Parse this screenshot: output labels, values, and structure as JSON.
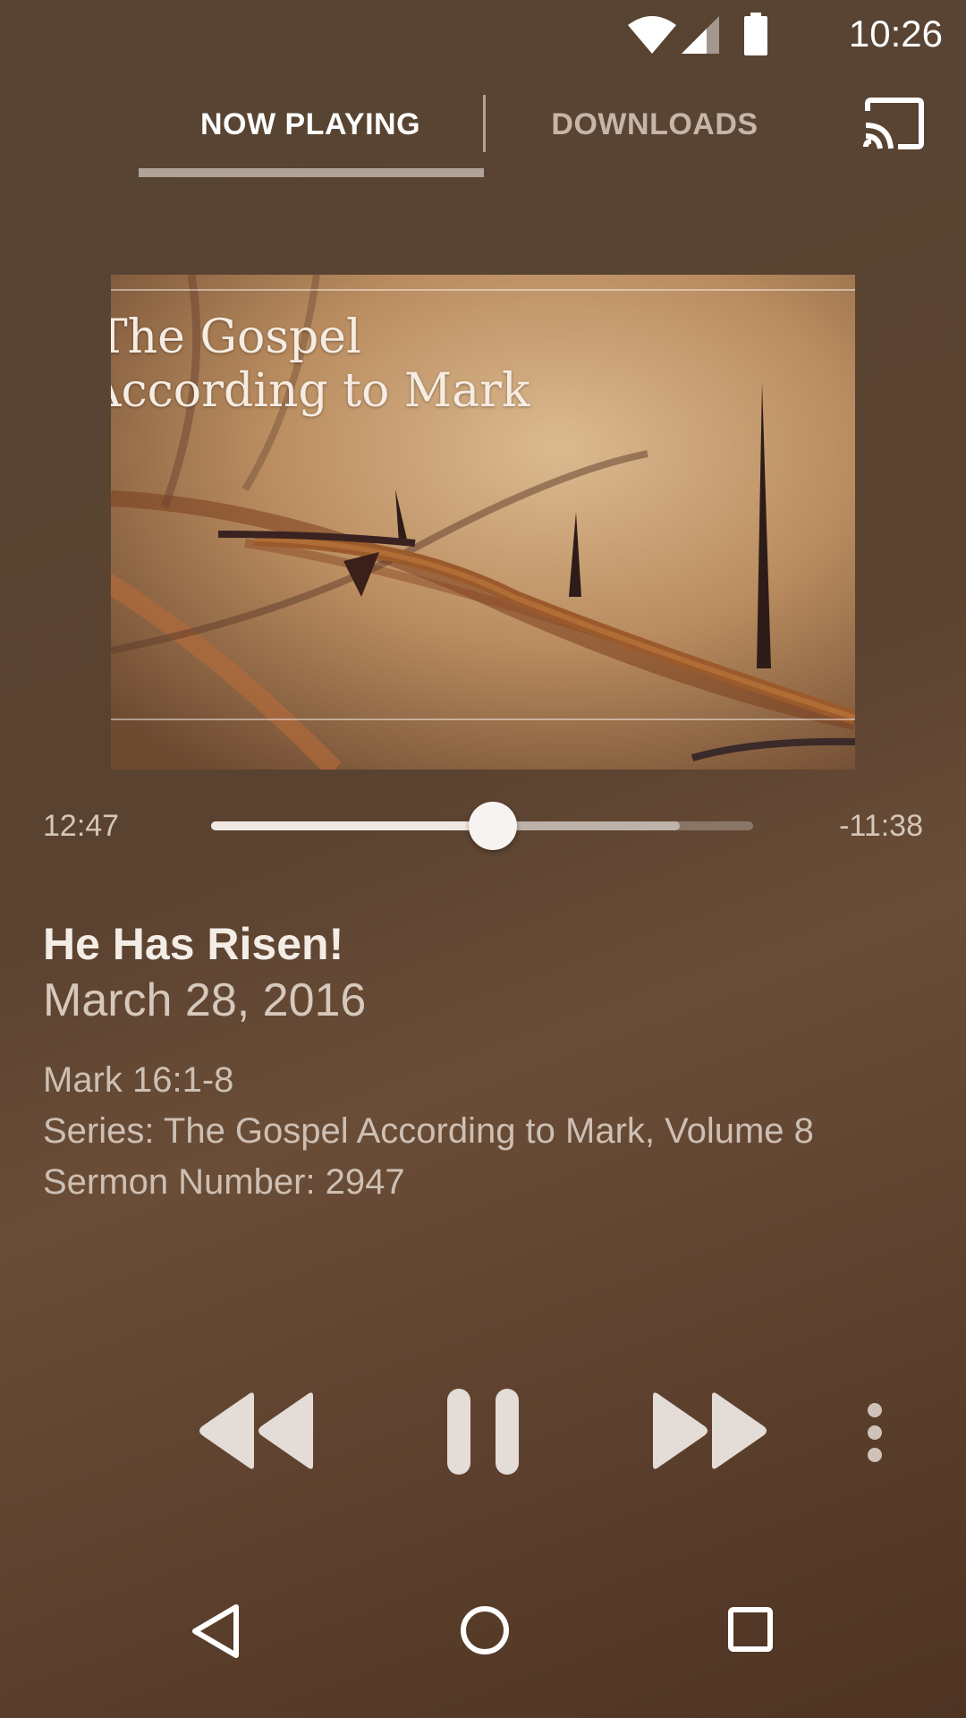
{
  "status_bar": {
    "time": "10:26",
    "icons": [
      "wifi-icon",
      "cell-signal-icon",
      "battery-icon"
    ]
  },
  "tabs": [
    {
      "label": "NOW PLAYING",
      "selected": true
    },
    {
      "label": "DOWNLOADS",
      "selected": false
    }
  ],
  "cast_icon": "cast-icon",
  "artwork": {
    "title_line1": "The Gospel",
    "title_line2": "According to Mark"
  },
  "playback": {
    "elapsed": "12:47",
    "remaining": "-11:38",
    "progress_fraction": 0.52,
    "buffered_fraction": 0.865
  },
  "sermon": {
    "title": "He Has Risen!",
    "date": "March 28, 2016",
    "scripture": "Mark 16:1-8",
    "series": "Series: The Gospel According to Mark, Volume 8",
    "number": "Sermon Number: 2947"
  },
  "controls": [
    "rewind-icon",
    "pause-icon",
    "fast-forward-icon",
    "more-vert-icon"
  ],
  "nav": [
    "back-icon",
    "home-icon",
    "recents-icon"
  ],
  "colors": {
    "background": "#5a4230",
    "accent": "#f0e9e3"
  }
}
